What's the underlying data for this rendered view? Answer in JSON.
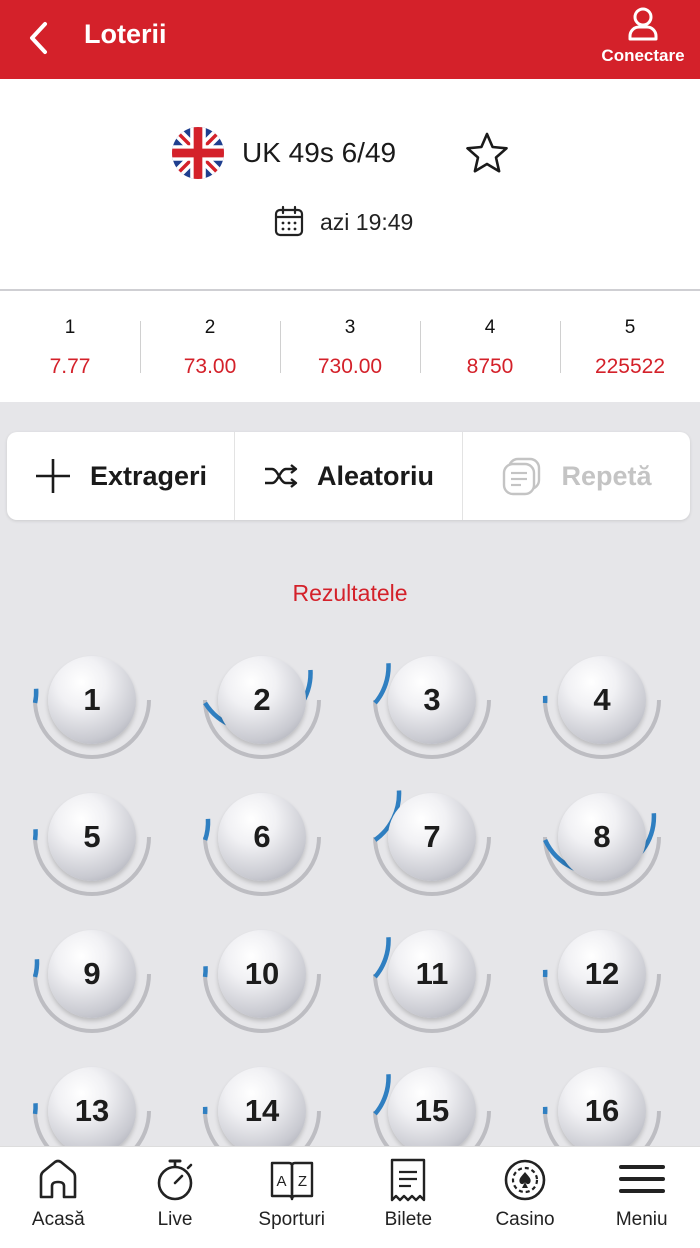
{
  "header": {
    "title": "Loterii",
    "login_label": "Conectare"
  },
  "event": {
    "name": "UK 49s 6/49",
    "time": "azi 19:49"
  },
  "odds": [
    {
      "key": "1",
      "value": "7.77"
    },
    {
      "key": "2",
      "value": "73.00"
    },
    {
      "key": "3",
      "value": "730.00"
    },
    {
      "key": "4",
      "value": "8750"
    },
    {
      "key": "5",
      "value": "225522"
    }
  ],
  "actions": {
    "draws_label": "Extrageri",
    "random_label": "Aleatoriu",
    "repeat_label": "Repetă"
  },
  "results": {
    "title": "Rezultatele"
  },
  "balls": [
    {
      "number": "1",
      "frequency": 0.04
    },
    {
      "number": "2",
      "frequency": 0.42
    },
    {
      "number": "3",
      "frequency": 0.12
    },
    {
      "number": "4",
      "frequency": 0.02
    },
    {
      "number": "5",
      "frequency": 0.03
    },
    {
      "number": "6",
      "frequency": 0.06
    },
    {
      "number": "7",
      "frequency": 0.16
    },
    {
      "number": "8",
      "frequency": 0.44
    },
    {
      "number": "9",
      "frequency": 0.05
    },
    {
      "number": "10",
      "frequency": 0.03
    },
    {
      "number": "11",
      "frequency": 0.12
    },
    {
      "number": "12",
      "frequency": 0.02
    },
    {
      "number": "13",
      "frequency": 0.03
    },
    {
      "number": "14",
      "frequency": 0.02
    },
    {
      "number": "15",
      "frequency": 0.12
    },
    {
      "number": "16",
      "frequency": 0.02
    }
  ],
  "colors": {
    "brand_red": "#d4212a",
    "ring_active": "#2f7fc1",
    "ring_track": "#bdbdc2"
  },
  "nav": [
    {
      "label": "Acasă",
      "icon": "home-icon"
    },
    {
      "label": "Live",
      "icon": "stopwatch-icon"
    },
    {
      "label": "Sporturi",
      "icon": "az-book-icon"
    },
    {
      "label": "Bilete",
      "icon": "ticket-icon"
    },
    {
      "label": "Casino",
      "icon": "casino-chip-icon"
    },
    {
      "label": "Meniu",
      "icon": "hamburger-menu-icon"
    }
  ]
}
